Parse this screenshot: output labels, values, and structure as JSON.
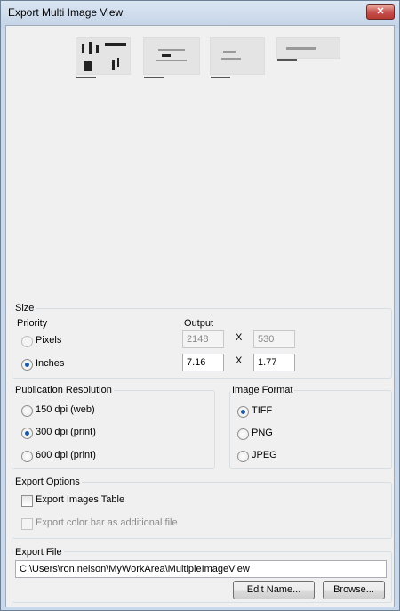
{
  "window": {
    "title": "Export Multi Image View",
    "close_glyph": "✕"
  },
  "size": {
    "legend": "Size",
    "priority_label": "Priority",
    "output_label": "Output",
    "pixels_label": "Pixels",
    "inches_label": "Inches",
    "pixels_width": "2148",
    "pixels_height": "530",
    "inches_width": "7.16",
    "inches_height": "1.77",
    "x_label": "X",
    "selected": "inches"
  },
  "resolution": {
    "legend": "Publication Resolution",
    "options": [
      "150 dpi (web)",
      "300 dpi (print)",
      "600 dpi (print)"
    ],
    "selected": "300 dpi (print)"
  },
  "format": {
    "legend": "Image Format",
    "options": [
      "TIFF",
      "PNG",
      "JPEG"
    ],
    "selected": "TIFF"
  },
  "export_options": {
    "legend": "Export Options",
    "images_table_label": "Export Images Table",
    "color_bar_label": "Export color bar as additional file"
  },
  "export_file": {
    "legend": "Export File",
    "path": "C:\\Users\\ron.nelson\\MyWorkArea\\MultipleImageView",
    "edit_button": "Edit Name...",
    "browse_button": "Browse..."
  }
}
